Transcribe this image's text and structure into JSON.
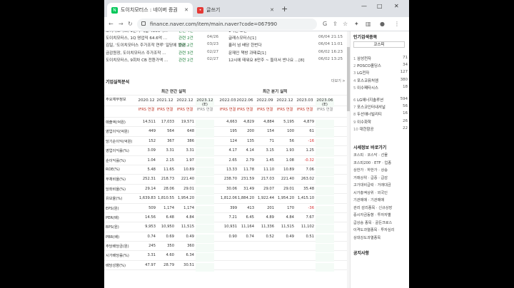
{
  "tabs": [
    {
      "label": "도이치모터스 : 네이버 증권",
      "active": true
    },
    {
      "label": "글쓰기",
      "active": false
    }
  ],
  "window": {
    "minimize": "—",
    "maximize": "□",
    "close": "✕",
    "new_tab": "+"
  },
  "address": {
    "url": "finance.naver.com/item/main.naver?code=067990"
  },
  "news": [
    {
      "title": "도이치모터스, 1분기 매출 4806억...",
      "source": "관련 4건",
      "date": "04/26",
      "t2": "1억원 보면",
      "t3": "06/04 21:25"
    },
    {
      "title": "도이치모터스, 1Q 영업익 64.6억 ...",
      "source": "관련 2건",
      "date": "04/26",
      "t2": "글래스모터스[1]",
      "t3": "06/04 21:15"
    },
    {
      "title": "김일, '도이치모터스 주가조작 연루' 일당에 벌금...",
      "source": "관련 2건",
      "date": "03/23",
      "t2": "흘러 넘 배당 한번다",
      "t3": "06/04 11:01"
    },
    {
      "title": "금감원장, 도이치모터스 주가조작 ...",
      "source": "관련 3건",
      "date": "02/27",
      "t2": "문재인 책방 과태료[1]",
      "t3": "06/02 16:23"
    },
    {
      "title": "도이치모터스, 9회차 CB 전환가액 ...",
      "source": "관련 2건",
      "date": "02/27",
      "t2": "12시에 태워요 8만주 ~ 들이서 반나요 ...[8]",
      "t3": "06/02 13:25"
    }
  ],
  "section": {
    "title": "기업실적분석",
    "more": "더보기 >"
  },
  "table": {
    "rowhead": "주요재무정보",
    "group_annual": "최근 연간 실적",
    "group_quarter": "최근 분기 실적",
    "periods": [
      "2020.12",
      "2021.12",
      "2022.12",
      "2023.12\n(E)",
      "2022.03",
      "2022.06",
      "2022.09",
      "2022.12",
      "2023.03",
      "2023.06\n(E)"
    ],
    "basis": "IFRS\n연결",
    "rows": [
      {
        "label": "매출액(억원)",
        "v": [
          "14,511",
          "17,033",
          "19,571",
          "",
          "4,663",
          "4,829",
          "4,884",
          "5,195",
          "4,879",
          ""
        ]
      },
      {
        "label": "영업이익(억원)",
        "v": [
          "449",
          "564",
          "648",
          "",
          "195",
          "200",
          "154",
          "100",
          "61",
          ""
        ]
      },
      {
        "label": "당기순이익(억원)",
        "v": [
          "152",
          "367",
          "386",
          "",
          "124",
          "135",
          "71",
          "56",
          "-16",
          ""
        ]
      },
      {
        "label": "영업이익률(%)",
        "v": [
          "3.09",
          "3.31",
          "3.31",
          "",
          "4.17",
          "4.14",
          "3.15",
          "1.93",
          "1.25",
          ""
        ]
      },
      {
        "label": "순이익률(%)",
        "v": [
          "1.04",
          "2.15",
          "1.97",
          "",
          "2.65",
          "2.79",
          "1.45",
          "1.08",
          "-0.32",
          ""
        ]
      },
      {
        "label": "ROE(%)",
        "v": [
          "5.48",
          "11.65",
          "10.89",
          "",
          "13.33",
          "11.78",
          "11.10",
          "10.89",
          "7.06",
          ""
        ]
      },
      {
        "label": "부채비율(%)",
        "v": [
          "252.31",
          "218.73",
          "221.40",
          "",
          "238.70",
          "231.59",
          "217.03",
          "221.40",
          "263.02",
          ""
        ]
      },
      {
        "label": "당좌비율(%)",
        "v": [
          "29.14",
          "28.06",
          "29.01",
          "",
          "30.06",
          "31.49",
          "29.07",
          "29.01",
          "35.48",
          ""
        ]
      },
      {
        "label": "유보율(%)",
        "v": [
          "1,639.83",
          "1,810.55",
          "1,954.20",
          "",
          "1,812.06",
          "1,884.20",
          "1,922.44",
          "1,954.20",
          "1,415.10",
          ""
        ]
      },
      {
        "label": "EPS(원)",
        "v": [
          "509",
          "1,174",
          "1,174",
          "",
          "399",
          "413",
          "201",
          "170",
          "-36",
          ""
        ]
      },
      {
        "label": "PER(배)",
        "v": [
          "14.56",
          "6.48",
          "4.84",
          "",
          "7.21",
          "6.45",
          "4.89",
          "4.84",
          "7.67",
          ""
        ]
      },
      {
        "label": "BPS(원)",
        "v": [
          "9,953",
          "10,950",
          "11,515",
          "",
          "10,931",
          "11,164",
          "11,336",
          "11,515",
          "11,102",
          ""
        ]
      },
      {
        "label": "PBR(배)",
        "v": [
          "0.74",
          "0.69",
          "0.49",
          "",
          "0.90",
          "0.74",
          "0.52",
          "0.49",
          "0.51",
          ""
        ]
      },
      {
        "label": "주당배당금(원)",
        "v": [
          "245",
          "350",
          "360",
          "",
          "",
          "",
          "",
          "",
          "",
          ""
        ]
      },
      {
        "label": "시가배당률(%)",
        "v": [
          "3.31",
          "4.60",
          "6.34",
          "",
          "",
          "",
          "",
          "",
          "",
          ""
        ]
      },
      {
        "label": "배당성향(%)",
        "v": [
          "47.97",
          "28.79",
          "30.51",
          "",
          "",
          "",
          "",
          "",
          "",
          ""
        ]
      }
    ]
  },
  "sidebar": {
    "popular_title": "인기검색종목",
    "tab_label": "코스피",
    "popular": [
      {
        "rank": "1",
        "name": "삼성전자",
        "v": "71"
      },
      {
        "rank": "2",
        "name": "POSCO홀딩스",
        "v": "34"
      },
      {
        "rank": "3",
        "name": "LG전자",
        "v": "127"
      },
      {
        "rank": "4",
        "name": "포스코퓨처엠",
        "v": "380"
      },
      {
        "rank": "5",
        "name": "이수페타시스",
        "v": "18"
      },
      {
        "rank": "6",
        "name": "LG에너지솔루션",
        "v": "594"
      },
      {
        "rank": "7",
        "name": "포스코인터내셔널",
        "v": "56"
      },
      {
        "rank": "8",
        "name": "두산에너빌리티",
        "v": "16"
      },
      {
        "rank": "9",
        "name": "이수화학",
        "v": "26"
      },
      {
        "rank": "10",
        "name": "대한항공",
        "v": "22"
      }
    ],
    "market_title": "시세정보 바로가기",
    "market": [
      "코스피 · 코스닥 · 선물",
      "코스피200 · ETF · 업종",
      "상한가 · 하한가 · 상승",
      "거래상위 · 급증 · 급감",
      "고가대비급락 · 거래대금",
      "시가총액상위 · 외국인",
      "기관매매 · 기관매매",
      "관리 감리종목 · 신규상장",
      "증시자금동향 · 투자자별",
      "급상승 종목 · 골든크로스",
      "이격도과열종목 · 투자심리",
      "상대강도과열종목"
    ],
    "notice_title": "공지사항"
  }
}
